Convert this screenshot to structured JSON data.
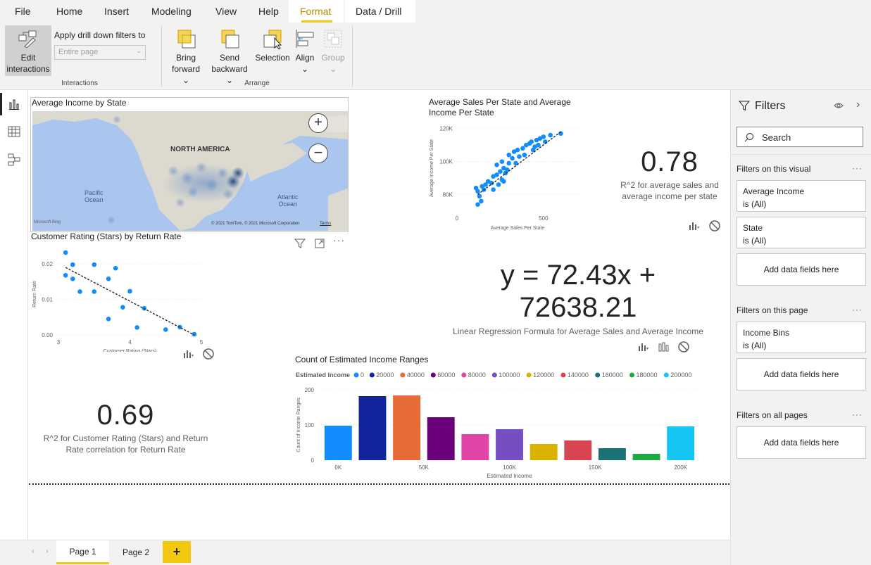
{
  "tabs": [
    "File",
    "Home",
    "Insert",
    "Modeling",
    "View",
    "Help",
    "Format",
    "Data / Drill"
  ],
  "ribbon": {
    "edit_interactions": [
      "Edit",
      "interactions"
    ],
    "apply_label": "Apply drill down filters to",
    "apply_value": "Entire page",
    "group_interactions": "Interactions",
    "bring_forward": [
      "Bring",
      "forward"
    ],
    "send_backward": [
      "Send",
      "backward"
    ],
    "selection": "Selection",
    "align": "Align",
    "group": "Group",
    "group_arrange": "Arrange"
  },
  "map": {
    "title": "Average Income by State",
    "north_america": "NORTH AMERICA",
    "pacific": [
      "Pacific",
      "Ocean"
    ],
    "atlantic": [
      "Atlantic",
      "Ocean"
    ],
    "bing": "Microsoft Bing",
    "copyright": "© 2021 TomTom, © 2021 Microsoft Corporation",
    "terms": "Terms"
  },
  "scatter1": {
    "title": [
      "Average Sales Per State and Average",
      "Income Per State"
    ],
    "chart_data": {
      "type": "scatter",
      "xlabel": "Average Sales Per State",
      "ylabel": "Average Income Per State",
      "xticks": [
        "0",
        "500"
      ],
      "yticks": [
        "80K",
        "100K",
        "120K"
      ],
      "xlim": [
        0,
        700
      ],
      "ylim": [
        70000,
        122000
      ],
      "points": [
        [
          120,
          74
        ],
        [
          130,
          79
        ],
        [
          140,
          76
        ],
        [
          110,
          84
        ],
        [
          120,
          82
        ],
        [
          145,
          85
        ],
        [
          155,
          83
        ],
        [
          165,
          86
        ],
        [
          180,
          88
        ],
        [
          200,
          87
        ],
        [
          210,
          91
        ],
        [
          230,
          92
        ],
        [
          250,
          94
        ],
        [
          260,
          89
        ],
        [
          270,
          96
        ],
        [
          280,
          93
        ],
        [
          290,
          95
        ],
        [
          300,
          99
        ],
        [
          230,
          98
        ],
        [
          260,
          100
        ],
        [
          300,
          104
        ],
        [
          320,
          102
        ],
        [
          330,
          106
        ],
        [
          350,
          107
        ],
        [
          380,
          108
        ],
        [
          390,
          104
        ],
        [
          400,
          110
        ],
        [
          420,
          111
        ],
        [
          430,
          112
        ],
        [
          450,
          109
        ],
        [
          460,
          113
        ],
        [
          480,
          114
        ],
        [
          510,
          112
        ],
        [
          540,
          116
        ],
        [
          600,
          117
        ],
        [
          210,
          83
        ],
        [
          240,
          86
        ],
        [
          270,
          88
        ],
        [
          340,
          99
        ],
        [
          360,
          103
        ],
        [
          440,
          107
        ],
        [
          470,
          110
        ],
        [
          500,
          115
        ]
      ],
      "trend": [
        [
          120,
          80
        ],
        [
          600,
          118
        ]
      ]
    }
  },
  "kpi1": {
    "value": "0.78",
    "label": [
      "R^2 for average sales and",
      "average income per state"
    ]
  },
  "scatter2": {
    "title": "Customer Rating (Stars) by Return Rate",
    "chart_data": {
      "type": "scatter",
      "xlabel": "Customer Rating (Stars)",
      "ylabel": "Return Rate",
      "xticks": [
        "3",
        "4",
        "5"
      ],
      "yticks": [
        "0.00",
        "0.01",
        "0.02"
      ],
      "xlim": [
        3,
        5
      ],
      "ylim": [
        0,
        0.023
      ],
      "points": [
        [
          3.1,
          0.0232
        ],
        [
          3.1,
          0.0168
        ],
        [
          3.2,
          0.0198
        ],
        [
          3.2,
          0.0158
        ],
        [
          3.3,
          0.0122
        ],
        [
          3.5,
          0.0198
        ],
        [
          3.5,
          0.0122
        ],
        [
          3.7,
          0.0158
        ],
        [
          3.8,
          0.0188
        ],
        [
          3.7,
          0.0045
        ],
        [
          3.9,
          0.0078
        ],
        [
          4.0,
          0.0123
        ],
        [
          4.1,
          0.0021
        ],
        [
          4.2,
          0.0075
        ],
        [
          4.5,
          0.0015
        ],
        [
          4.7,
          0.0022
        ],
        [
          4.9,
          0.0002
        ]
      ],
      "trend": [
        [
          3.1,
          0.019
        ],
        [
          4.9,
          0.0
        ]
      ]
    }
  },
  "kpi2": {
    "value": "0.69",
    "label": [
      "R^2 for Customer Rating (Stars) and Return",
      "Rate correlation for Return Rate"
    ]
  },
  "formula": {
    "line1": "y = 72.43x +",
    "line2": "72638.21",
    "label": "Linear Regression Formula for Average Sales and Average Income"
  },
  "bar": {
    "title": "Count of Estimated Income Ranges",
    "legend_title": "Estimated Income",
    "chart_data": {
      "type": "bar",
      "categories": [
        "0",
        "20000",
        "40000",
        "60000",
        "80000",
        "100000",
        "120000",
        "140000",
        "160000",
        "180000",
        "200000"
      ],
      "values": [
        98,
        182,
        184,
        122,
        74,
        88,
        46,
        56,
        34,
        18,
        96
      ],
      "colors": [
        "#118dff",
        "#12239e",
        "#e66c37",
        "#6b007b",
        "#e044a7",
        "#744ec2",
        "#d9b300",
        "#d64550",
        "#197278",
        "#1aab40",
        "#15c6f4"
      ],
      "xlabel": "Estimated Income",
      "ylabel": "Count of Income Ranges",
      "xticks": [
        "0K",
        "50K",
        "100K",
        "150K",
        "200K"
      ],
      "yticks": [
        "0",
        "100",
        "200"
      ],
      "ylim": [
        0,
        200
      ]
    }
  },
  "filters": {
    "title": "Filters",
    "search": "Search",
    "on_visual": "Filters on this visual",
    "avg_income": [
      "Average Income",
      "is (All)"
    ],
    "state": [
      "State",
      "is (All)"
    ],
    "add": "Add data fields here",
    "on_page": "Filters on this page",
    "income_bins": [
      "Income Bins",
      "is (All)"
    ],
    "on_all": "Filters on all pages"
  },
  "pages": [
    "Page 1",
    "Page 2"
  ],
  "add_page": "+"
}
